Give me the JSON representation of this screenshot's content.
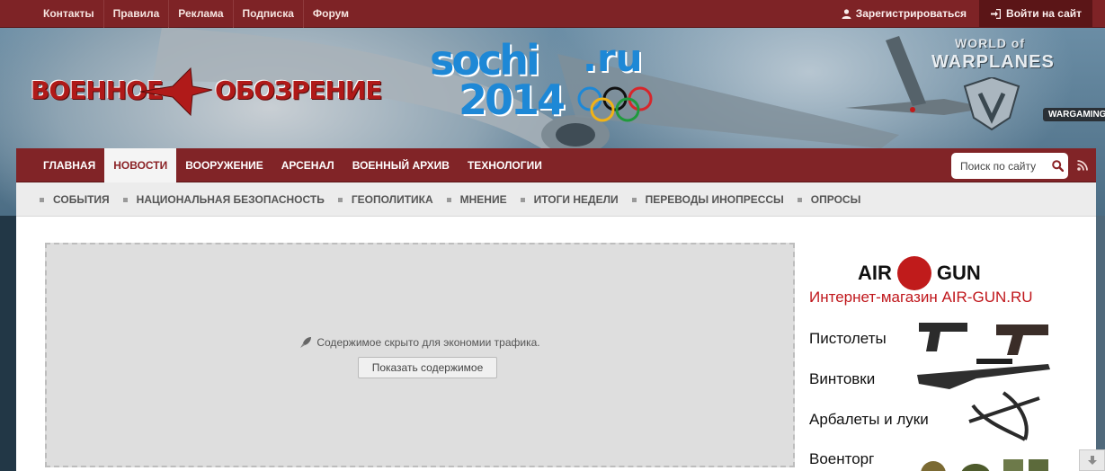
{
  "topbar": {
    "links": [
      "Контакты",
      "Правила",
      "Реклама",
      "Подписка",
      "Форум"
    ],
    "register_label": "Зарегистрироваться",
    "login_label": "Войти на сайт"
  },
  "header": {
    "logo_word_1": "ВОЕННОЕ",
    "logo_word_2": "ОБОЗРЕНИЕ",
    "sochi_line_1": "sochi",
    "sochi_ru": ".ru",
    "sochi_line_2": "2014",
    "wowp_line_1": "WORLD of",
    "wowp_line_2": "WARPLANES",
    "wargaming": "WARGAMING"
  },
  "mainnav": {
    "items": [
      "ГЛАВНАЯ",
      "НОВОСТИ",
      "ВООРУЖЕНИЕ",
      "АРСЕНАЛ",
      "ВОЕННЫЙ АРХИВ",
      "ТЕХНОЛОГИИ"
    ],
    "active_index": 1,
    "search_placeholder": "Поиск по сайту"
  },
  "subnav": {
    "items": [
      "СОБЫТИЯ",
      "НАЦИОНАЛЬНАЯ БЕЗОПАСНОСТЬ",
      "ГЕОПОЛИТИКА",
      "МНЕНИЕ",
      "ИТОГИ НЕДЕЛИ",
      "ПЕРЕВОДЫ ИНОПРЕССЫ",
      "ОПРОСЫ"
    ]
  },
  "content": {
    "hidden_message": "Содержимое скрыто для экономии трафика.",
    "show_button_label": "Показать содержимое"
  },
  "ad": {
    "brand_left": "AIR",
    "brand_right": "GUN",
    "tagline": "Интернет-магазин AIR-GUN.RU",
    "categories": [
      "Пистолеты",
      "Винтовки",
      "Арбалеты и луки",
      "Военторг"
    ]
  },
  "colors": {
    "brand_red": "#812427",
    "topbar_red": "#7e2326",
    "ad_red": "#c0171c",
    "sochi_blue": "#1e88d6"
  }
}
